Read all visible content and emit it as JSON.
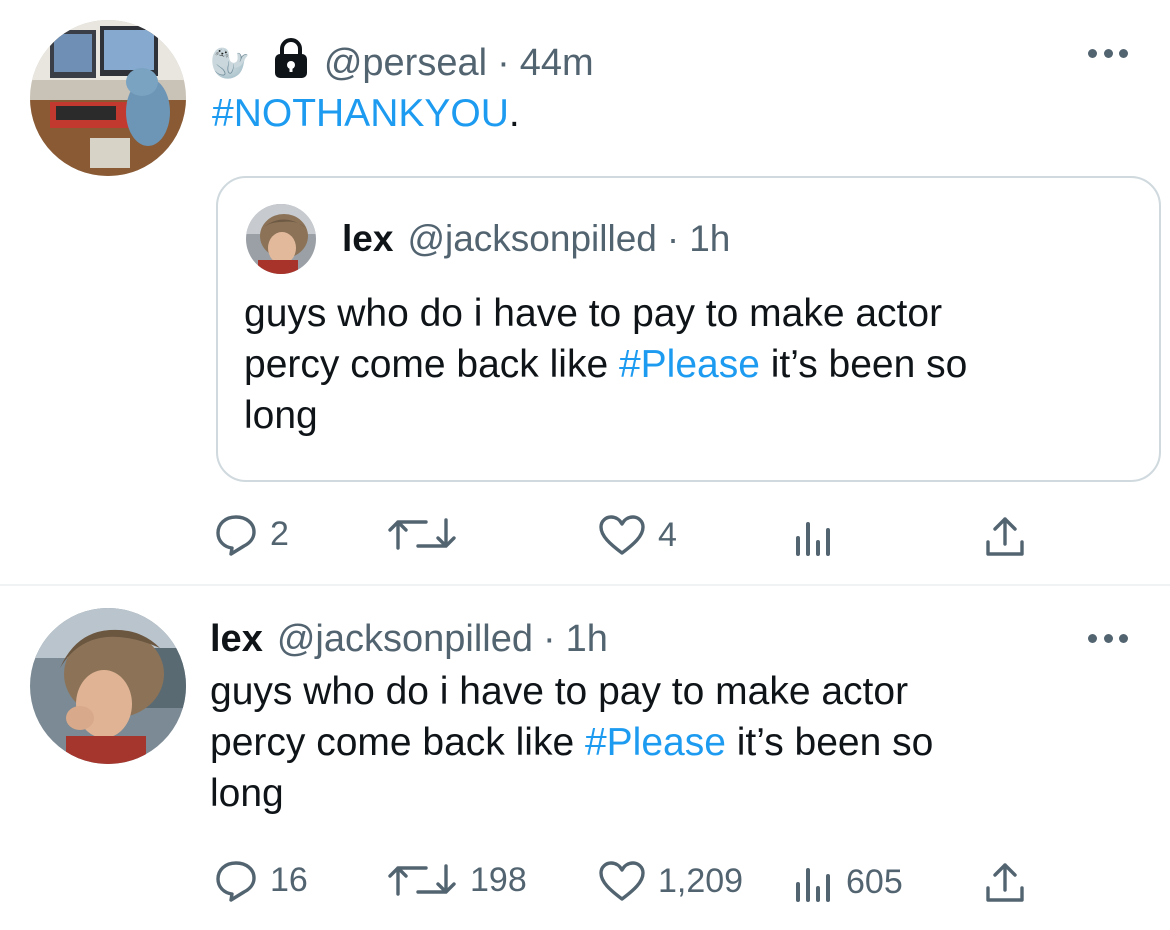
{
  "tweet1": {
    "handle": "@perseal",
    "dot": "·",
    "time": "44m",
    "emoji": "🦭",
    "hashtag": "#NOTHANKYOU",
    "trailing": ".",
    "more_icon": "more-horizontal-icon",
    "lock_icon": "lock-icon",
    "quote": {
      "name": "lex",
      "handle": "@jacksonpilled",
      "dot": "·",
      "time": "1h",
      "text_line1": "guys who do i have to pay to make actor",
      "text_line2_pre": "percy come back like ",
      "hashtag": "#Please",
      "text_line2_post": " it’s been so",
      "text_line3": "long"
    },
    "actions": {
      "reply_count": "2",
      "retweet_count": "",
      "like_count": "4",
      "views_count": ""
    }
  },
  "tweet2": {
    "name": "lex",
    "handle": "@jacksonpilled",
    "dot": "·",
    "time": "1h",
    "text_line1": "guys who do i have to pay to make actor",
    "text_line2_pre": "percy come back like ",
    "hashtag": "#Please",
    "text_line2_post": " it’s been so",
    "text_line3": "long",
    "actions": {
      "reply_count": "16",
      "retweet_count": "198",
      "like_count": "1,209",
      "views_count": "605"
    }
  },
  "colors": {
    "accent": "#1d9bf0",
    "text_primary": "#0f1419",
    "text_secondary": "#536471",
    "border": "#cfd9de"
  }
}
